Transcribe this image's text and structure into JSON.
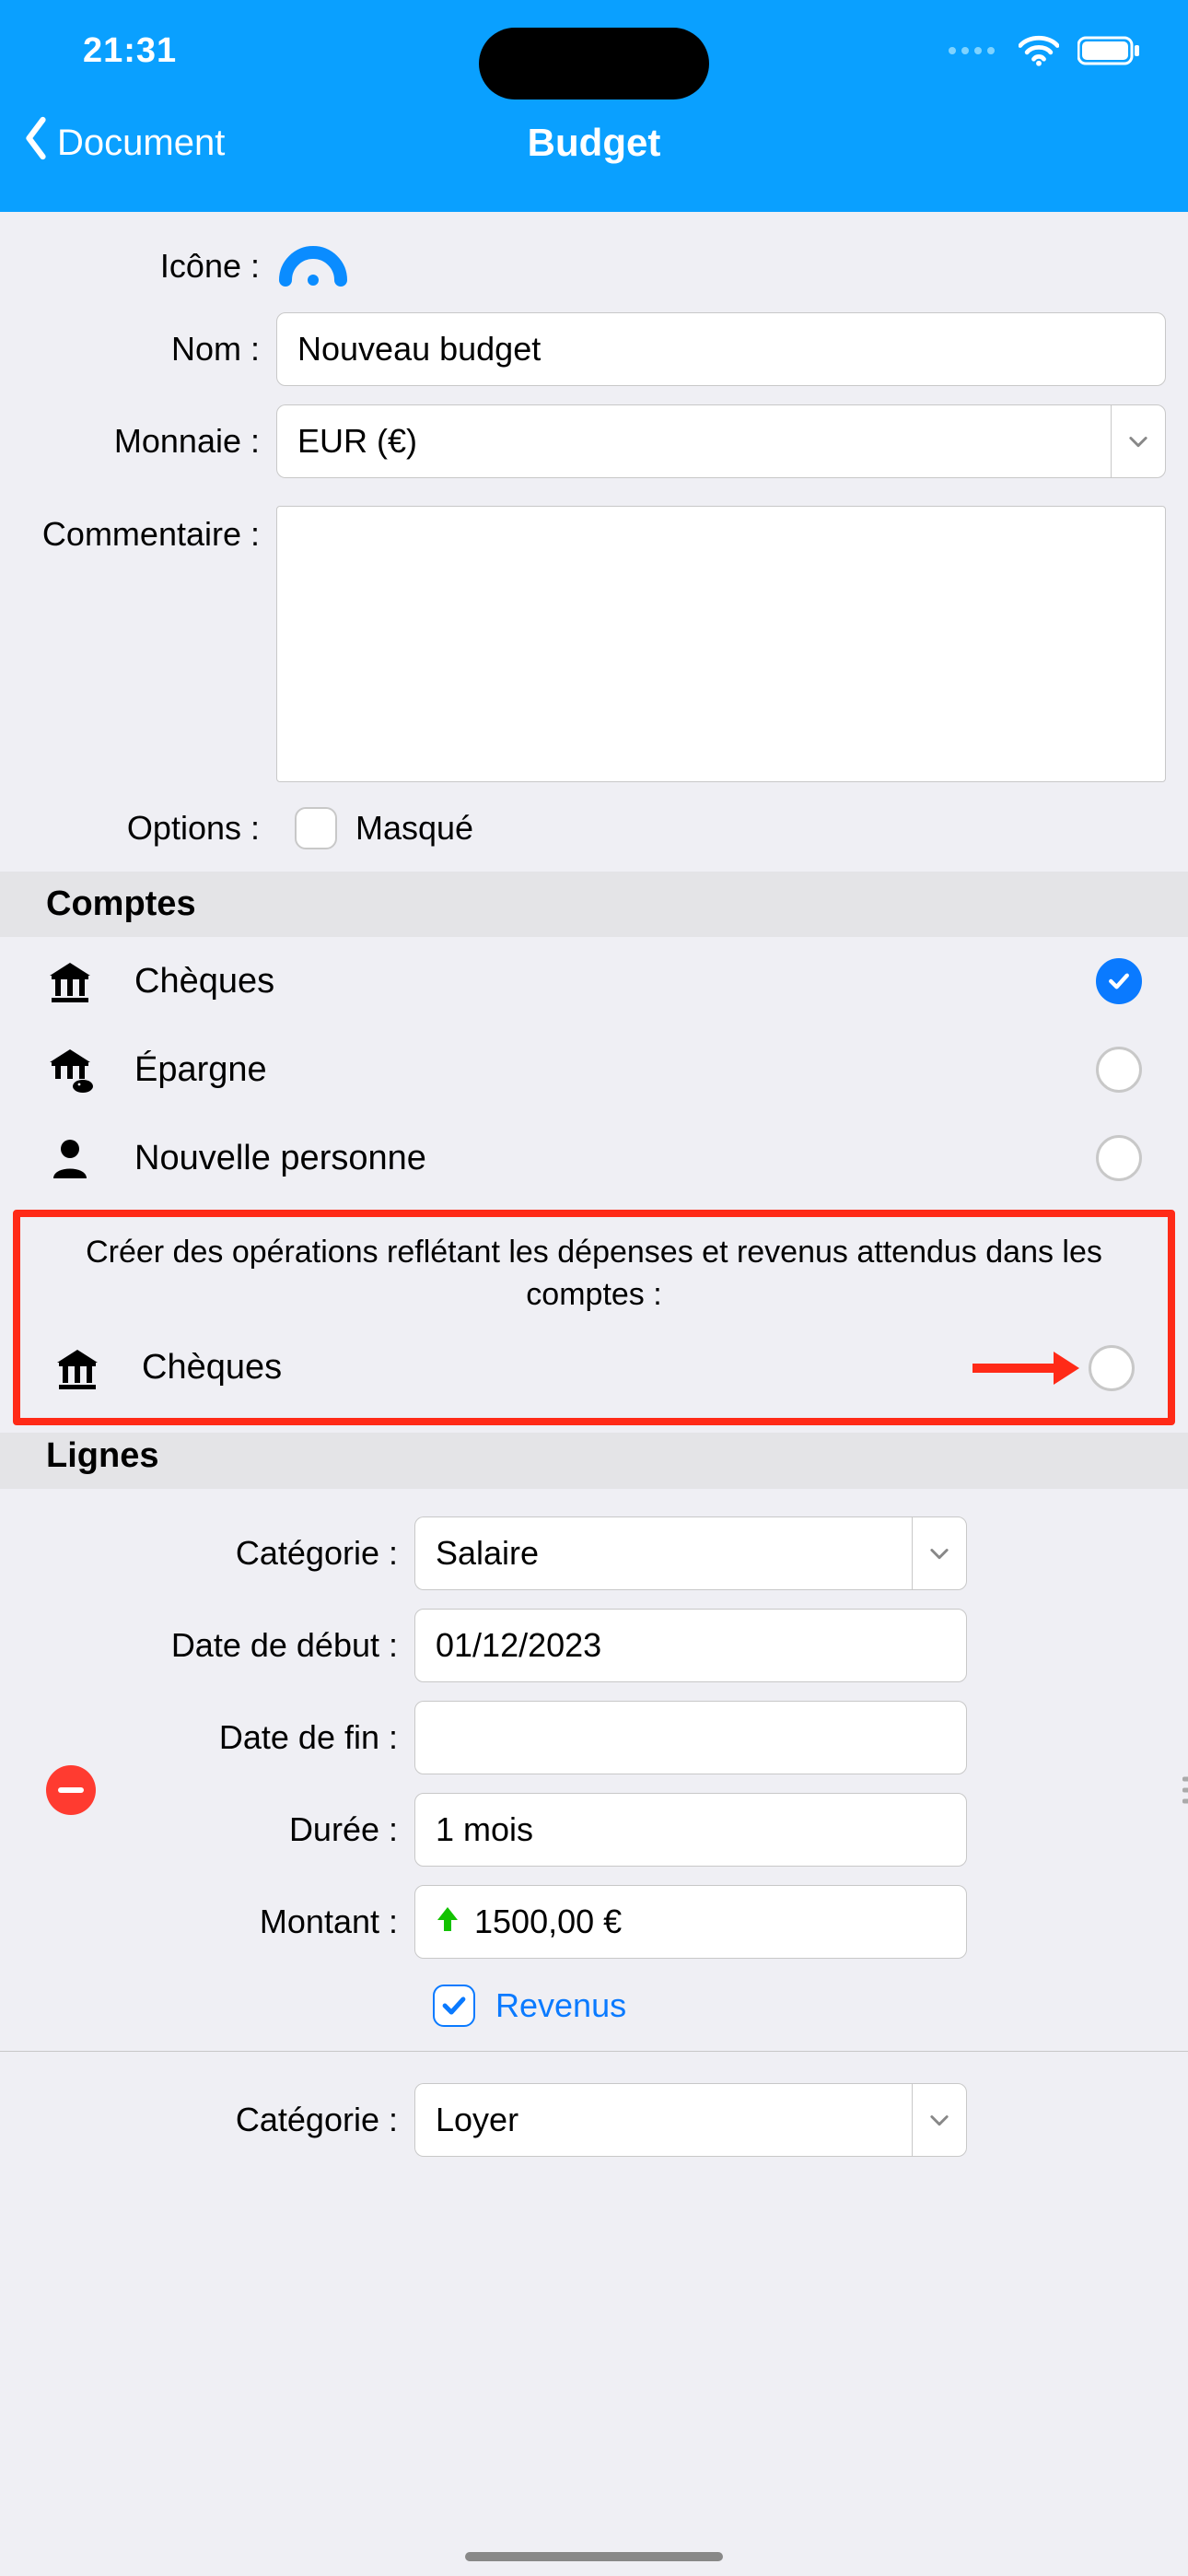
{
  "status": {
    "time": "21:31"
  },
  "nav": {
    "back": "Document",
    "title": "Budget"
  },
  "form": {
    "icon_label": "Icône :",
    "name_label": "Nom :",
    "name_value": "Nouveau budget",
    "currency_label": "Monnaie :",
    "currency_value": "EUR (€)",
    "comment_label": "Commentaire :",
    "comment_value": "",
    "options_label": "Options :",
    "hidden_label": "Masqué"
  },
  "accounts": {
    "header": "Comptes",
    "items": [
      {
        "icon": "bank",
        "label": "Chèques",
        "selected": true
      },
      {
        "icon": "bank-piggy",
        "label": "Épargne",
        "selected": false
      },
      {
        "icon": "person",
        "label": "Nouvelle personne",
        "selected": false
      }
    ]
  },
  "highlight": {
    "text": "Créer des opérations reflétant les dépenses et revenus attendus dans les comptes :",
    "account_label": "Chèques"
  },
  "lines": {
    "header": "Lignes",
    "labels": {
      "category": "Catégorie :",
      "start": "Date de début :",
      "end": "Date de fin :",
      "duration": "Durée :",
      "amount": "Montant :",
      "revenus": "Revenus"
    },
    "entries": [
      {
        "category": "Salaire",
        "start": "01/12/2023",
        "end": "",
        "duration": "1 mois",
        "amount": "1500,00 €",
        "is_revenue": true
      },
      {
        "category": "Loyer"
      }
    ]
  }
}
